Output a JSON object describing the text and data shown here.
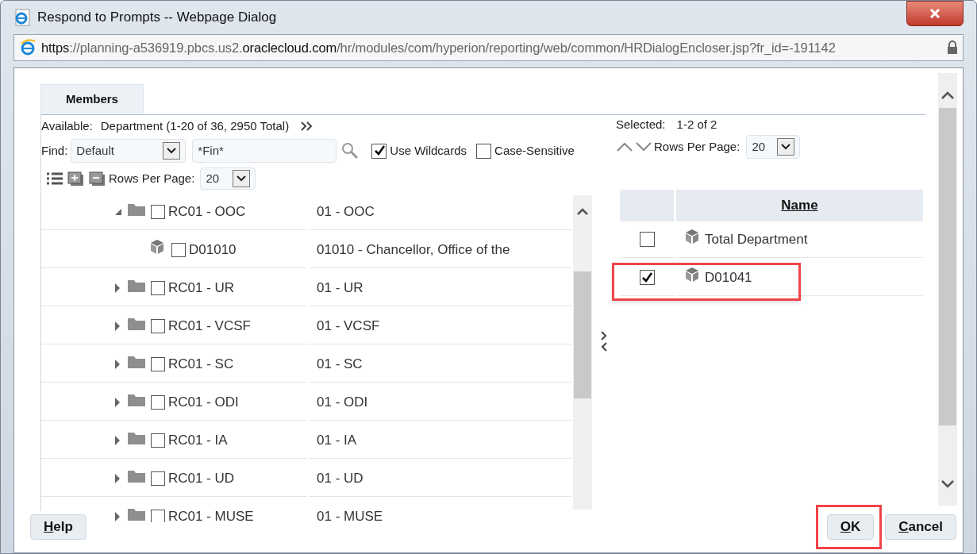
{
  "window": {
    "title": "Respond to Prompts -- Webpage Dialog"
  },
  "address_bar": {
    "url_parts": [
      {
        "text": "https",
        "emphasis": true
      },
      {
        "text": "://planning-a536919.pbcs.us2.",
        "emphasis": false
      },
      {
        "text": "oraclecloud.com",
        "emphasis": true
      },
      {
        "text": "/hr/modules/com/hyperion/reporting/web/common/HRDialogEncloser.jsp?fr_id=-191142",
        "emphasis": false
      }
    ]
  },
  "tabs": [
    {
      "label": "Members",
      "selected": true
    }
  ],
  "available": {
    "label": "Available:",
    "value": "Department (1-20 of 36, 2950 Total)"
  },
  "find": {
    "label": "Find:",
    "dropdown": "Default",
    "search_value": "*Fin*"
  },
  "search_options": [
    {
      "label": "Use Wildcards",
      "checked": true
    },
    {
      "label": "Case-Sensitive",
      "checked": false
    }
  ],
  "left_rows_per_page": {
    "label": "Rows Per Page:",
    "value": "20"
  },
  "tree": [
    {
      "kind": "folder",
      "name": "RC01 - OOC",
      "description": "01 - OOC",
      "expanded": true,
      "checked": false,
      "children": [
        {
          "kind": "member",
          "name": "D01010",
          "description": "01010 - Chancellor, Office of the",
          "checked": false
        }
      ]
    },
    {
      "kind": "folder",
      "name": "RC01 - UR",
      "description": "01 - UR",
      "expanded": false,
      "checked": false
    },
    {
      "kind": "folder",
      "name": "RC01 - VCSF",
      "description": "01 - VCSF",
      "expanded": false,
      "checked": false
    },
    {
      "kind": "folder",
      "name": "RC01 - SC",
      "description": "01 - SC",
      "expanded": false,
      "checked": false
    },
    {
      "kind": "folder",
      "name": "RC01 - ODI",
      "description": "01 - ODI",
      "expanded": false,
      "checked": false
    },
    {
      "kind": "folder",
      "name": "RC01 - IA",
      "description": "01 - IA",
      "expanded": false,
      "checked": false
    },
    {
      "kind": "folder",
      "name": "RC01 - UD",
      "description": "01 - UD",
      "expanded": false,
      "checked": false
    },
    {
      "kind": "folder",
      "name": "RC01 - MUSE",
      "description": "01 - MUSE",
      "expanded": false,
      "checked": false
    }
  ],
  "selected_panel": {
    "label": "Selected:",
    "value": "1-2 of 2",
    "rows_per_page": {
      "label": "Rows Per Page:",
      "value": "20"
    }
  },
  "selected_table": {
    "columns": [
      "Name"
    ],
    "rows": [
      {
        "name": "Total Department",
        "checked": false,
        "highlighted": false
      },
      {
        "name": "D01041",
        "checked": true,
        "highlighted": true
      }
    ]
  },
  "buttons": [
    {
      "label": "Help",
      "highlighted": false
    },
    {
      "label": "OK",
      "highlighted": true
    },
    {
      "label": "Cancel",
      "highlighted": false
    }
  ]
}
